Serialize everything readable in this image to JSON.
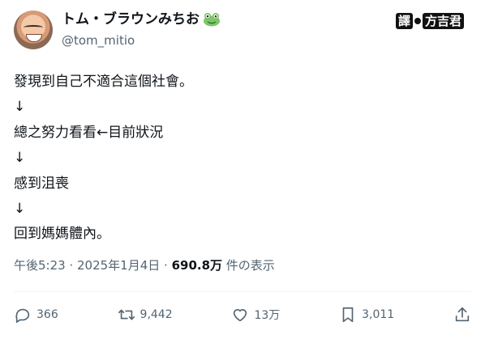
{
  "author": {
    "display_name": "トム・ブラウンみちお",
    "handle": "@tom_mitio",
    "name_emoji_icon": "frog-face-icon",
    "avatar_icon": "profile-photo"
  },
  "watermark": {
    "left_text": "譯",
    "right_text": "方吉君"
  },
  "tweet": {
    "lines": [
      "發現到自己不適合這個社會。",
      "↓",
      "總之努力看看←目前狀況",
      "↓",
      "感到沮喪",
      "↓",
      "回到媽媽體內。"
    ]
  },
  "meta": {
    "time": "午後5:23",
    "separator": " · ",
    "date": "2025年1月4日",
    "separator2": " · ",
    "views": "690.8万",
    "views_suffix": " 件の表示"
  },
  "actions": {
    "reply_count": "366",
    "retweet_count": "9,442",
    "like_count": "13万",
    "bookmark_count": "3,011"
  },
  "colors": {
    "text": "#0f1419",
    "muted": "#536471",
    "divider": "#eff3f4",
    "frog_green": "#7cc56a"
  }
}
